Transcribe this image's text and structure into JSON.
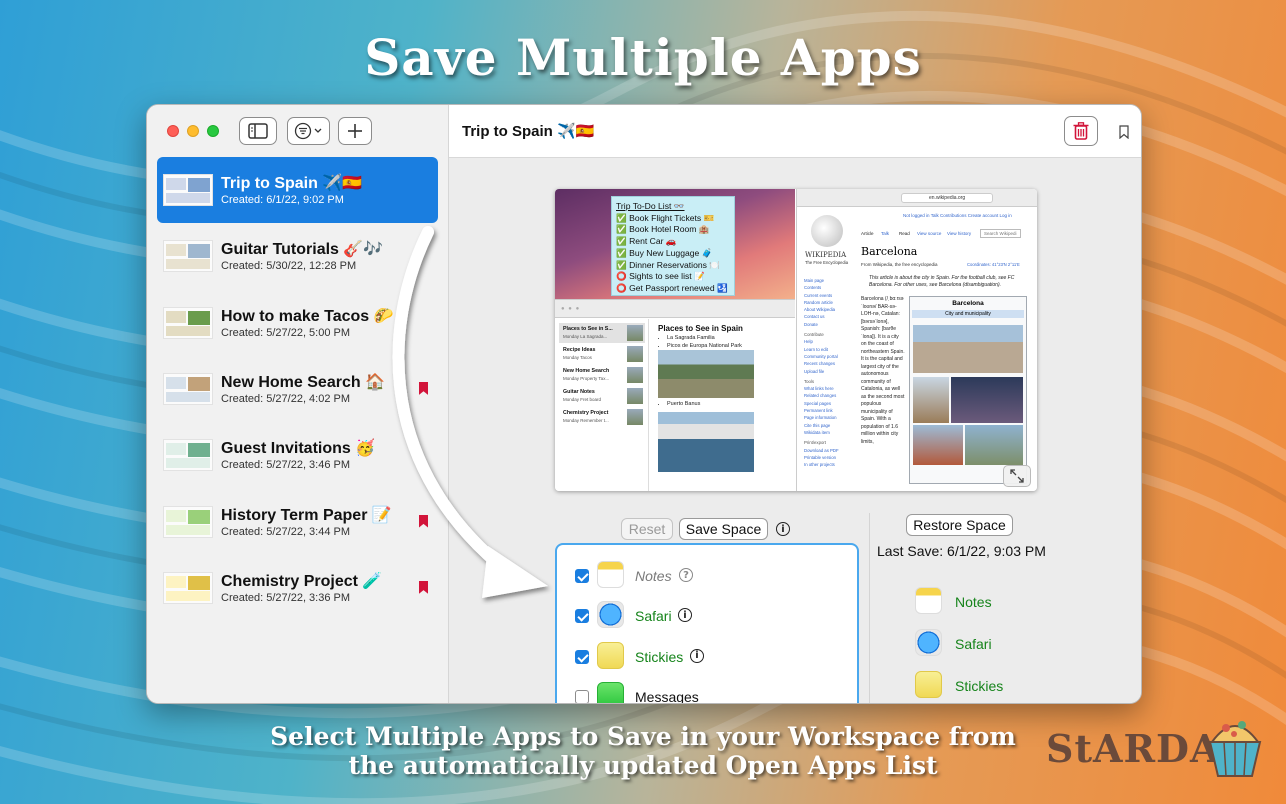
{
  "headline": "Save Multiple Apps",
  "subline": [
    "Select Multiple Apps to Save in your Workspace from",
    "the automatically updated Open Apps List"
  ],
  "brand": "StARDAE",
  "colors": {
    "accent": "#1a7ee0",
    "bookmark": "#d2143a",
    "saved_app": "#16841b",
    "trash": "#d2143a"
  },
  "sidebar": {
    "icons": [
      "sidebar-toggle-icon",
      "filter-icon",
      "plus-icon"
    ],
    "items": [
      {
        "title": "Trip to Spain ✈️🇪🇸",
        "date": "Created: 6/1/22, 9:02 PM",
        "selected": true,
        "bookmarked": false
      },
      {
        "title": "Guitar Tutorials 🎸🎶",
        "date": "Created: 5/30/22, 12:28 PM",
        "selected": false,
        "bookmarked": false
      },
      {
        "title": "How to make Tacos 🌮",
        "date": "Created: 5/27/22, 5:00 PM",
        "selected": false,
        "bookmarked": false
      },
      {
        "title": "New Home Search 🏠",
        "date": "Created: 5/27/22, 4:02 PM",
        "selected": false,
        "bookmarked": true
      },
      {
        "title": "Guest Invitations 🥳",
        "date": "Created: 5/27/22, 3:46 PM",
        "selected": false,
        "bookmarked": false
      },
      {
        "title": "History Term Paper 📝",
        "date": "Created: 5/27/22, 3:44 PM",
        "selected": false,
        "bookmarked": true
      },
      {
        "title": "Chemistry Project 🧪",
        "date": "Created: 5/27/22, 3:36 PM",
        "selected": false,
        "bookmarked": true
      }
    ]
  },
  "main": {
    "title": "Trip to Spain ✈️🇪🇸",
    "preview": {
      "stickies": [
        "Trip To-Do List 👓",
        "✅ Book Flight Tickets 🎫",
        "✅ Book Hotel Room 🏨",
        "✅ Rent Car 🚗",
        "✅ Buy New Luggage 🧳",
        "✅ Dinner Reservations 🍽️",
        "⭕ Sights to see list 📝",
        "⭕ Get Passport renewed 🛂"
      ],
      "notes_list": [
        {
          "t": "Places to See in S...",
          "s": "Monday  La Sagrada..."
        },
        {
          "t": "Recipe Ideas",
          "s": "Monday  Tacos"
        },
        {
          "t": "New Home Search",
          "s": "Monday  Property Tax..."
        },
        {
          "t": "Guitar Notes",
          "s": "Monday  Fret board"
        },
        {
          "t": "Chemistry Project",
          "s": "Monday  Remember t..."
        }
      ],
      "note_title": "Places to See in Spain",
      "note_bullets": [
        "La Sagrada Familia",
        "Picos de Europa National Park"
      ],
      "note_bullet2": "Puerto Banus",
      "wiki_url": "en.wikipedia.org",
      "wiki_title": "Barcelona",
      "wiki_from": "From Wikipedia, the free encyclopedia",
      "wiki_brand": "WIKIPEDIA",
      "wiki_tagline": "The Free Encyclopedia",
      "wiki_hatnote": "This article is about the city in Spain. For the football club, see FC Barcelona. For other uses, see Barcelona (disambiguation).",
      "wiki_body": "Barcelona (/ˌbɑːrsəˈloʊnə/ BAR-sə-LOH-nə, Catalan: [bəɾsəˈlonə], Spanish: [baɾθeˈlona]). It is a city on the coast of northeastern Spain. It is the capital and largest city of the autonomous community of Catalonia, as well as the second most populous municipality of Spain. With a population of 1.6 million within city limits,",
      "wiki_infobox_title": "Barcelona",
      "wiki_infobox_sub": "City and municipality",
      "wiki_nav": [
        "Main page",
        "Contents",
        "Current events",
        "Random article",
        "About Wikipedia",
        "Contact us",
        "Donate",
        "Contribute",
        "Help",
        "Learn to edit",
        "Community portal",
        "Recent changes",
        "Upload file",
        "Tools",
        "What links here",
        "Related changes",
        "Special pages",
        "Permanent link",
        "Page information",
        "Cite this page",
        "Wikidata item",
        "Print/export",
        "Download as PDF",
        "Printable version",
        "In other projects"
      ],
      "wiki_tabs": [
        "Article",
        "Talk",
        "Read",
        "View source",
        "View history"
      ],
      "wiki_search": "Search Wikipedi",
      "wiki_user": "Not logged in  Talk  Contributions  Create account  Log in",
      "wiki_coords": "Coordinates: 41°23′N 2°11′E"
    },
    "reset_label": "Reset",
    "save_label": "Save Space",
    "restore_label": "Restore Space",
    "last_save": "Last Save: 6/1/22, 9:03 PM",
    "apps": [
      {
        "name": "Notes",
        "checked": true,
        "icon": "notes-icon",
        "color": "#7a7a7a",
        "italic": true,
        "info": "?"
      },
      {
        "name": "Safari",
        "checked": true,
        "icon": "safari-icon",
        "color": "#16841b",
        "italic": false,
        "info": "i"
      },
      {
        "name": "Stickies",
        "checked": true,
        "icon": "stickies-icon",
        "color": "#16841b",
        "italic": false,
        "info": "i"
      },
      {
        "name": "Messages",
        "checked": false,
        "icon": "messages-icon",
        "color": "#111111",
        "italic": false,
        "info": ""
      }
    ],
    "saved_apps": [
      {
        "name": "Notes",
        "icon": "notes-icon"
      },
      {
        "name": "Safari",
        "icon": "safari-icon"
      },
      {
        "name": "Stickies",
        "icon": "stickies-icon"
      }
    ]
  }
}
